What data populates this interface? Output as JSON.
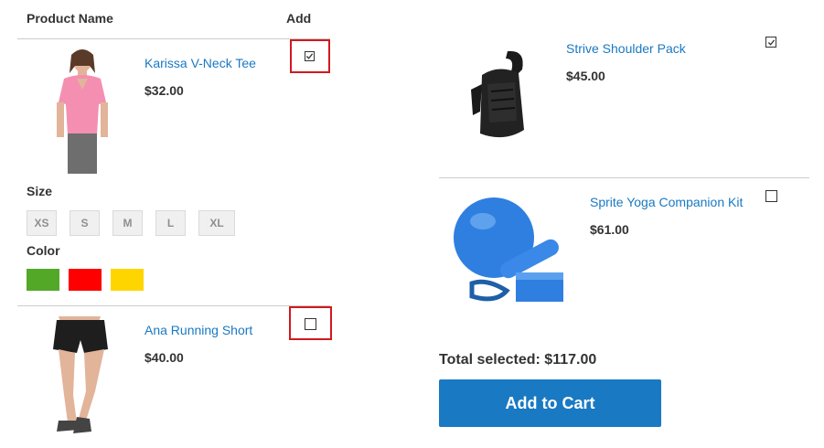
{
  "table": {
    "header_name": "Product Name",
    "header_add": "Add"
  },
  "products": [
    {
      "name": "Karissa V-Neck Tee",
      "price": "$32.00",
      "checked": true,
      "image": "pink-tshirt-woman"
    },
    {
      "name": "Ana Running Short",
      "price": "$40.00",
      "checked": false,
      "image": "black-shorts-woman"
    },
    {
      "name": "Strive Shoulder Pack",
      "price": "$45.00",
      "checked": true,
      "image": "black-shoulder-bag"
    },
    {
      "name": "Sprite Yoga Companion Kit",
      "price": "$61.00",
      "checked": false,
      "image": "blue-yoga-ball-kit"
    }
  ],
  "options": {
    "size_label": "Size",
    "sizes": [
      "XS",
      "S",
      "M",
      "L",
      "XL"
    ],
    "color_label": "Color",
    "colors": [
      "#53a828",
      "#ff0000",
      "#ffd500"
    ]
  },
  "summary": {
    "total_text": "Total selected: $117.00",
    "button_label": "Add to Cart"
  },
  "accent": "#1979c3",
  "highlight": "#d0191f"
}
